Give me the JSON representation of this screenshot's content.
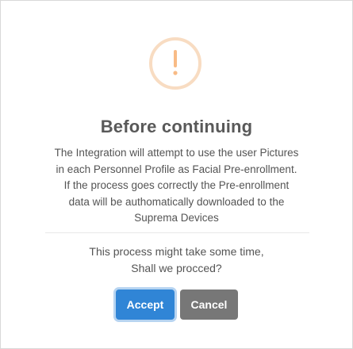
{
  "dialog": {
    "icon": "exclamation-warning-icon",
    "icon_color": "#f8bb86",
    "title": "Before continuing",
    "body_lines": [
      "The Integration will attempt to use the user Pictures",
      "in each Personnel Profile as Facial Pre-enrollment.",
      "If the process goes correctly the Pre-enrollment",
      "data will be authomatically downloaded to the",
      "Suprema Devices"
    ],
    "question_lines": [
      "This process might take some time,",
      "Shall we procced?"
    ],
    "accept_label": "Accept",
    "cancel_label": "Cancel",
    "accept_color": "#3085d6",
    "cancel_color": "#777777"
  }
}
